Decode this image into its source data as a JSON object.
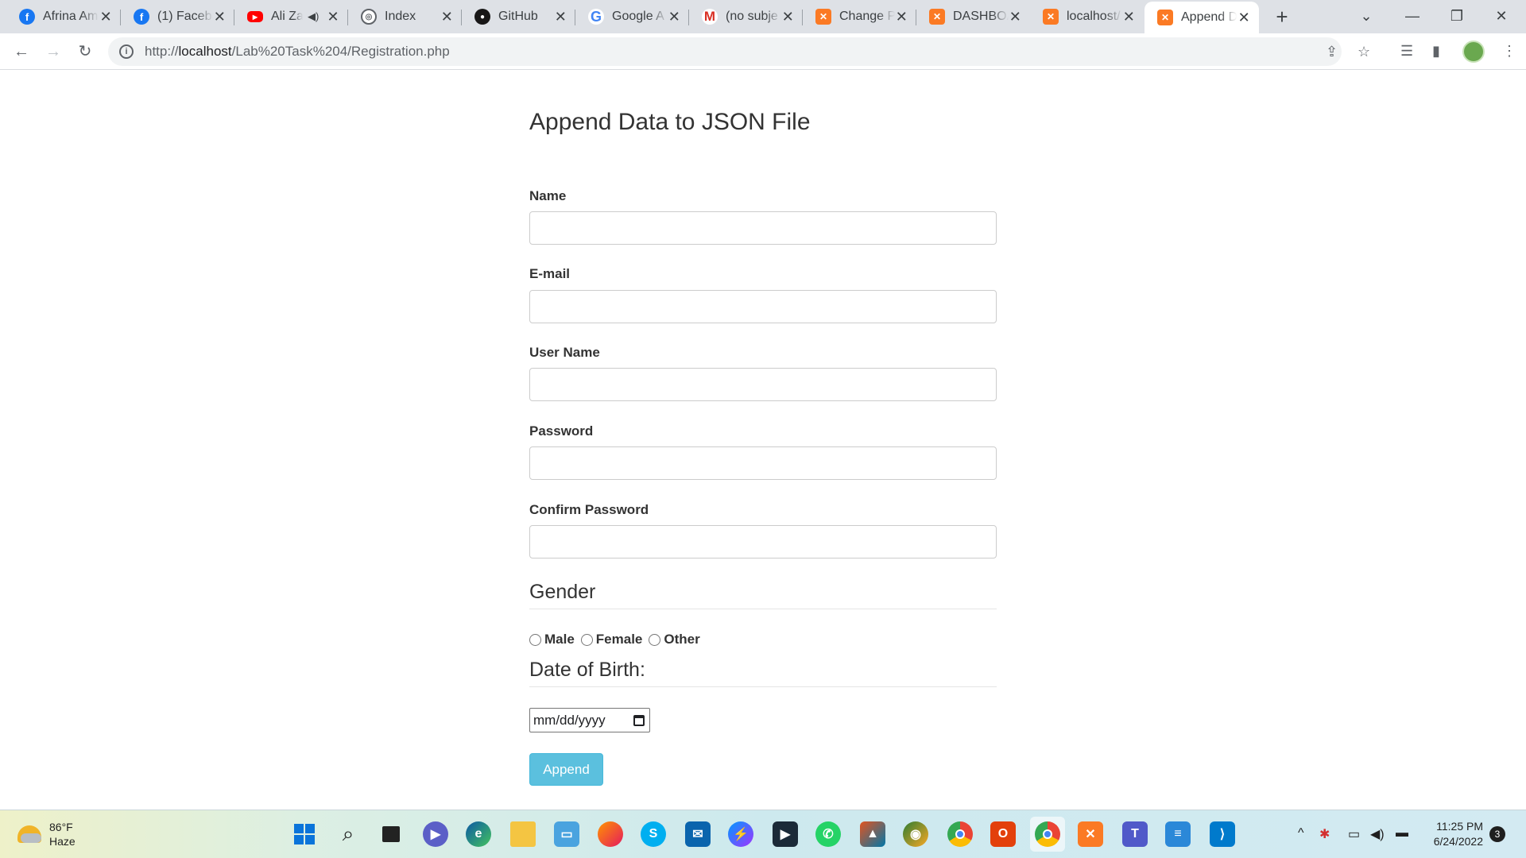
{
  "browser": {
    "tabs": [
      {
        "title": "Afrina Am",
        "icon": "facebook-icon",
        "fav": "f"
      },
      {
        "title": "(1) Facebo",
        "icon": "facebook-icon",
        "fav": "f"
      },
      {
        "title": "Ali Za",
        "icon": "youtube-icon",
        "fav": "▶"
      },
      {
        "title": "Index",
        "icon": "globe-icon",
        "fav": "◎"
      },
      {
        "title": "GitHub",
        "icon": "github-icon",
        "fav": "●"
      },
      {
        "title": "Google A",
        "icon": "google-icon",
        "fav": "G"
      },
      {
        "title": "(no subje",
        "icon": "gmail-icon",
        "fav": "M"
      },
      {
        "title": "Change P",
        "icon": "xampp-icon",
        "fav": "✕"
      },
      {
        "title": "DASHBOA",
        "icon": "xampp-icon",
        "fav": "✕"
      },
      {
        "title": "localhost/",
        "icon": "xampp-icon",
        "fav": "✕"
      },
      {
        "title": "Append D",
        "icon": "xampp-icon",
        "fav": "✕"
      }
    ],
    "url_prefix": "http://",
    "url_host": "localhost",
    "url_path": "/Lab%20Task%204/Registration.php"
  },
  "form": {
    "heading": "Append Data to JSON File",
    "name_label": "Name",
    "email_label": "E-mail",
    "username_label": "User Name",
    "password_label": "Password",
    "confirm_label": "Confirm Password",
    "gender_legend": "Gender",
    "gender_options": [
      "Male",
      "Female",
      "Other"
    ],
    "dob_legend": "Date of Birth:",
    "dob_placeholder": "mm/dd/yyyy",
    "submit_label": "Append"
  },
  "taskbar": {
    "weather_temp": "86°F",
    "weather_desc": "Haze",
    "time": "11:25 PM",
    "date": "6/24/2022",
    "notification_count": "3"
  }
}
